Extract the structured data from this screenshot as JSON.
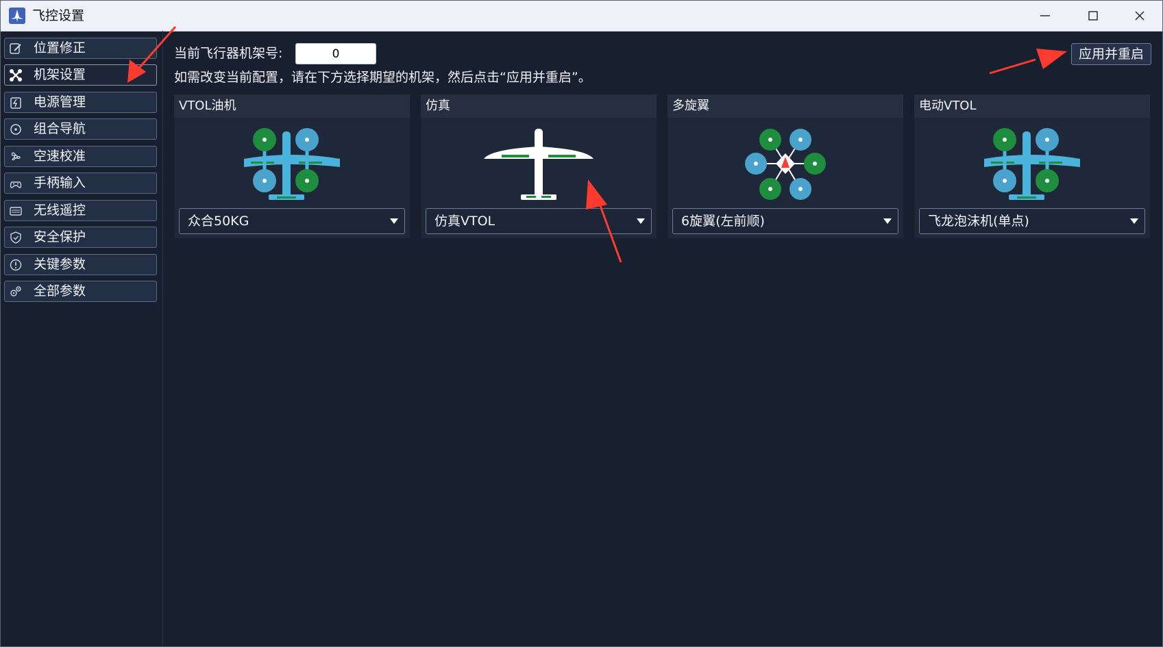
{
  "window": {
    "title": "飞控设置"
  },
  "sidebar": {
    "items": [
      {
        "label": "位置修正",
        "icon": "edit-icon"
      },
      {
        "label": "机架设置",
        "icon": "drone-icon"
      },
      {
        "label": "电源管理",
        "icon": "power-icon"
      },
      {
        "label": "组合导航",
        "icon": "compass-icon"
      },
      {
        "label": "空速校准",
        "icon": "fan-icon"
      },
      {
        "label": "手柄输入",
        "icon": "gamepad-icon"
      },
      {
        "label": "无线遥控",
        "icon": "remote-icon"
      },
      {
        "label": "安全保护",
        "icon": "shield-icon"
      },
      {
        "label": "关键参数",
        "icon": "alert-icon"
      },
      {
        "label": "全部参数",
        "icon": "gears-icon"
      }
    ],
    "active_index": 1
  },
  "main": {
    "frame_label": "当前飞行器机架号:",
    "frame_value": "0",
    "instruction": "如需改变当前配置，请在下方选择期望的机架，然后点击“应用并重启”。",
    "apply_label": "应用并重启",
    "cards": [
      {
        "title": "VTOL油机",
        "selected": "众合50KG",
        "image": "vtol-aircraft-icon"
      },
      {
        "title": "仿真",
        "selected": "仿真VTOL",
        "image": "fixed-wing-aircraft-icon"
      },
      {
        "title": "多旋翼",
        "selected": "6旋翼(左前顺)",
        "image": "hexacopter-icon"
      },
      {
        "title": "电动VTOL",
        "selected": "飞龙泡沫机(单点)",
        "image": "vtol-aircraft-icon"
      }
    ]
  },
  "colors": {
    "background": "#182030",
    "card": "#262f40",
    "rotor_green": "#1e8e3e",
    "rotor_blue": "#4aa3cc",
    "airframe_blue": "#4ab4dc",
    "annotation_red": "#ff3b30"
  }
}
